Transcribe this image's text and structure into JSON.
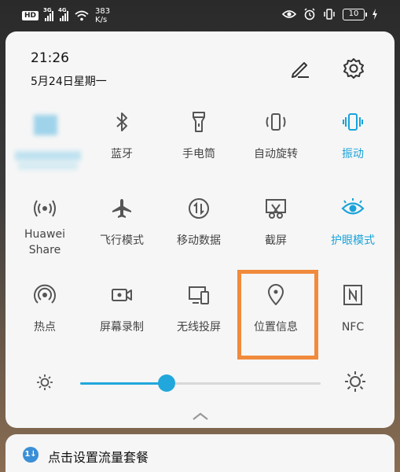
{
  "status_bar": {
    "hd_badge": "HD",
    "sim1_tag": "3G",
    "sim2_tag": "4G",
    "net_speed_value": "383",
    "net_speed_unit": "K/s",
    "battery": "10"
  },
  "header": {
    "time": "21:26",
    "date": "5月24日星期一"
  },
  "tiles": [
    {
      "id": "bluetooth",
      "label": "蓝牙",
      "icon": "bluetooth-icon",
      "active": false
    },
    {
      "id": "flashlight",
      "label": "手电筒",
      "icon": "flashlight-icon",
      "active": false
    },
    {
      "id": "auto-rotate",
      "label": "自动旋转",
      "icon": "rotate-icon",
      "active": false
    },
    {
      "id": "vibrate",
      "label": "振动",
      "icon": "vibrate-icon",
      "active": true
    },
    {
      "id": "huawei-share",
      "label_line1": "Huawei",
      "label_line2": "Share",
      "icon": "huawei-share-icon",
      "active": false
    },
    {
      "id": "airplane-mode",
      "label": "飞行模式",
      "icon": "airplane-icon",
      "active": false
    },
    {
      "id": "mobile-data",
      "label": "移动数据",
      "icon": "mobile-data-icon",
      "active": false
    },
    {
      "id": "screenshot",
      "label": "截屏",
      "icon": "scissors-icon",
      "active": false
    },
    {
      "id": "eye-comfort",
      "label": "护眼模式",
      "icon": "eye-icon",
      "active": true
    },
    {
      "id": "hotspot",
      "label": "热点",
      "icon": "hotspot-icon",
      "active": false
    },
    {
      "id": "screen-record",
      "label": "屏幕录制",
      "icon": "video-camera-icon",
      "active": false
    },
    {
      "id": "wireless-projection",
      "label": "无线投屏",
      "icon": "projection-icon",
      "active": false
    },
    {
      "id": "location",
      "label": "位置信息",
      "icon": "location-pin-icon",
      "active": false
    },
    {
      "id": "nfc",
      "label": "NFC",
      "icon": "nfc-icon",
      "active": false
    }
  ],
  "brightness": {
    "level_fraction": 0.36
  },
  "notification": {
    "icon_text": "1↓",
    "text": "点击设置流量套餐"
  },
  "colors": {
    "accent": "#1aa3d9",
    "highlight": "#f08a3c",
    "panel_bg": "#f6f6f6"
  }
}
